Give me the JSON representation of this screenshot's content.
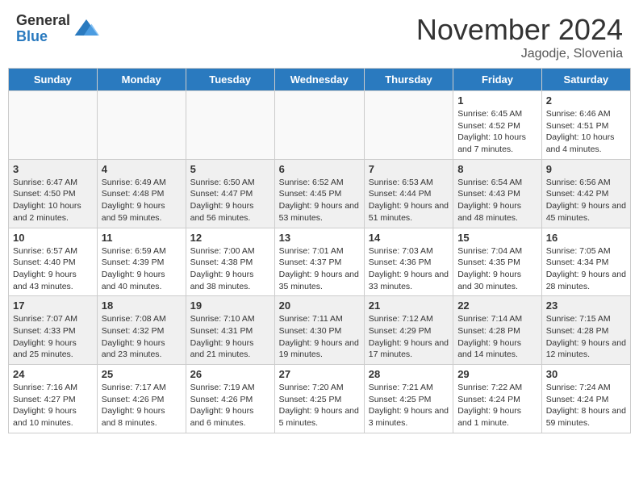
{
  "logo": {
    "general": "General",
    "blue": "Blue"
  },
  "title": "November 2024",
  "location": "Jagodje, Slovenia",
  "days_of_week": [
    "Sunday",
    "Monday",
    "Tuesday",
    "Wednesday",
    "Thursday",
    "Friday",
    "Saturday"
  ],
  "weeks": [
    [
      {
        "day": "",
        "info": ""
      },
      {
        "day": "",
        "info": ""
      },
      {
        "day": "",
        "info": ""
      },
      {
        "day": "",
        "info": ""
      },
      {
        "day": "",
        "info": ""
      },
      {
        "day": "1",
        "info": "Sunrise: 6:45 AM\nSunset: 4:52 PM\nDaylight: 10 hours and 7 minutes."
      },
      {
        "day": "2",
        "info": "Sunrise: 6:46 AM\nSunset: 4:51 PM\nDaylight: 10 hours and 4 minutes."
      }
    ],
    [
      {
        "day": "3",
        "info": "Sunrise: 6:47 AM\nSunset: 4:50 PM\nDaylight: 10 hours and 2 minutes."
      },
      {
        "day": "4",
        "info": "Sunrise: 6:49 AM\nSunset: 4:48 PM\nDaylight: 9 hours and 59 minutes."
      },
      {
        "day": "5",
        "info": "Sunrise: 6:50 AM\nSunset: 4:47 PM\nDaylight: 9 hours and 56 minutes."
      },
      {
        "day": "6",
        "info": "Sunrise: 6:52 AM\nSunset: 4:45 PM\nDaylight: 9 hours and 53 minutes."
      },
      {
        "day": "7",
        "info": "Sunrise: 6:53 AM\nSunset: 4:44 PM\nDaylight: 9 hours and 51 minutes."
      },
      {
        "day": "8",
        "info": "Sunrise: 6:54 AM\nSunset: 4:43 PM\nDaylight: 9 hours and 48 minutes."
      },
      {
        "day": "9",
        "info": "Sunrise: 6:56 AM\nSunset: 4:42 PM\nDaylight: 9 hours and 45 minutes."
      }
    ],
    [
      {
        "day": "10",
        "info": "Sunrise: 6:57 AM\nSunset: 4:40 PM\nDaylight: 9 hours and 43 minutes."
      },
      {
        "day": "11",
        "info": "Sunrise: 6:59 AM\nSunset: 4:39 PM\nDaylight: 9 hours and 40 minutes."
      },
      {
        "day": "12",
        "info": "Sunrise: 7:00 AM\nSunset: 4:38 PM\nDaylight: 9 hours and 38 minutes."
      },
      {
        "day": "13",
        "info": "Sunrise: 7:01 AM\nSunset: 4:37 PM\nDaylight: 9 hours and 35 minutes."
      },
      {
        "day": "14",
        "info": "Sunrise: 7:03 AM\nSunset: 4:36 PM\nDaylight: 9 hours and 33 minutes."
      },
      {
        "day": "15",
        "info": "Sunrise: 7:04 AM\nSunset: 4:35 PM\nDaylight: 9 hours and 30 minutes."
      },
      {
        "day": "16",
        "info": "Sunrise: 7:05 AM\nSunset: 4:34 PM\nDaylight: 9 hours and 28 minutes."
      }
    ],
    [
      {
        "day": "17",
        "info": "Sunrise: 7:07 AM\nSunset: 4:33 PM\nDaylight: 9 hours and 25 minutes."
      },
      {
        "day": "18",
        "info": "Sunrise: 7:08 AM\nSunset: 4:32 PM\nDaylight: 9 hours and 23 minutes."
      },
      {
        "day": "19",
        "info": "Sunrise: 7:10 AM\nSunset: 4:31 PM\nDaylight: 9 hours and 21 minutes."
      },
      {
        "day": "20",
        "info": "Sunrise: 7:11 AM\nSunset: 4:30 PM\nDaylight: 9 hours and 19 minutes."
      },
      {
        "day": "21",
        "info": "Sunrise: 7:12 AM\nSunset: 4:29 PM\nDaylight: 9 hours and 17 minutes."
      },
      {
        "day": "22",
        "info": "Sunrise: 7:14 AM\nSunset: 4:28 PM\nDaylight: 9 hours and 14 minutes."
      },
      {
        "day": "23",
        "info": "Sunrise: 7:15 AM\nSunset: 4:28 PM\nDaylight: 9 hours and 12 minutes."
      }
    ],
    [
      {
        "day": "24",
        "info": "Sunrise: 7:16 AM\nSunset: 4:27 PM\nDaylight: 9 hours and 10 minutes."
      },
      {
        "day": "25",
        "info": "Sunrise: 7:17 AM\nSunset: 4:26 PM\nDaylight: 9 hours and 8 minutes."
      },
      {
        "day": "26",
        "info": "Sunrise: 7:19 AM\nSunset: 4:26 PM\nDaylight: 9 hours and 6 minutes."
      },
      {
        "day": "27",
        "info": "Sunrise: 7:20 AM\nSunset: 4:25 PM\nDaylight: 9 hours and 5 minutes."
      },
      {
        "day": "28",
        "info": "Sunrise: 7:21 AM\nSunset: 4:25 PM\nDaylight: 9 hours and 3 minutes."
      },
      {
        "day": "29",
        "info": "Sunrise: 7:22 AM\nSunset: 4:24 PM\nDaylight: 9 hours and 1 minute."
      },
      {
        "day": "30",
        "info": "Sunrise: 7:24 AM\nSunset: 4:24 PM\nDaylight: 8 hours and 59 minutes."
      }
    ]
  ]
}
